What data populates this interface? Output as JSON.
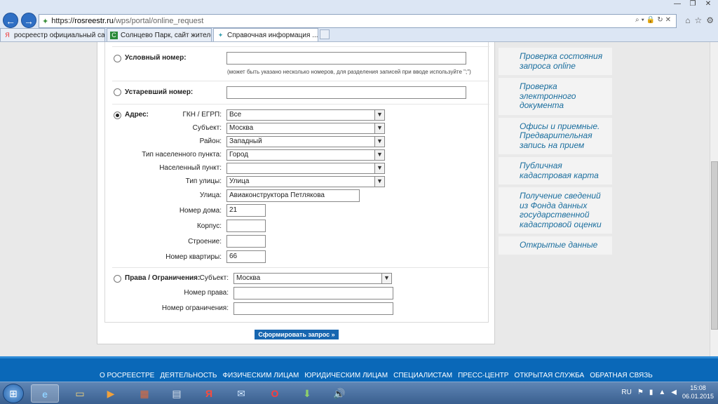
{
  "browser": {
    "url_domain": "rosreestr.ru",
    "url_path": "/wps/portal/online_request",
    "url_scheme": "https://",
    "tabs": [
      {
        "label": "росреестр официальный сай...",
        "favicon": "yandex-icon",
        "color": "#e33"
      },
      {
        "label": "Солнцево Парк, сайт жителе...",
        "favicon": "c-site-icon",
        "color": "#2a8a3a"
      },
      {
        "label": "Справочная информация ...",
        "favicon": "rosreestr-icon",
        "color": "#3aa0b0"
      }
    ]
  },
  "form": {
    "conditional_number": {
      "label": "Условный номер:",
      "value": "",
      "hint": "(может быть указано несколько номеров, для разделения записей при вводе используйте \";\")"
    },
    "old_number": {
      "label": "Устаревший номер:",
      "value": ""
    },
    "address": {
      "label": "Адрес:",
      "checked": true,
      "rows": [
        {
          "label": "ГКН / ЕГРП:",
          "type": "select",
          "value": "Все"
        },
        {
          "label": "Субъект:",
          "type": "select",
          "value": "Москва"
        },
        {
          "label": "Район:",
          "type": "select",
          "value": "Западный"
        },
        {
          "label": "Тип населенного пункта:",
          "type": "select",
          "value": "Город"
        },
        {
          "label": "Населенный пункт:",
          "type": "select",
          "value": ""
        },
        {
          "label": "Тип улицы:",
          "type": "select",
          "value": "Улица"
        },
        {
          "label": "Улица:",
          "type": "text",
          "value": "Авиаконструктора Петлякова"
        },
        {
          "label": "Номер дома:",
          "type": "text",
          "value": "21"
        },
        {
          "label": "Корпус:",
          "type": "text",
          "value": ""
        },
        {
          "label": "Строение:",
          "type": "text",
          "value": ""
        },
        {
          "label": "Номер квартиры:",
          "type": "text",
          "value": "66"
        }
      ]
    },
    "rights": {
      "label": "Права / Ограничения:",
      "subject_label": "Субъект:",
      "subject_value": "Москва",
      "right_number_label": "Номер права:",
      "right_number_value": "",
      "restriction_label": "Номер ограничения:",
      "restriction_value": ""
    },
    "submit_label": "Сформировать запрос »"
  },
  "sidebar": [
    "Проверка состояния запроса online",
    "Проверка электронного документа",
    "Офисы и приемные. Предварительная запись на прием",
    "Публичная кадастровая карта",
    "Получение сведений из Фонда данных государственной кадастровой оценки",
    "Открытые данные"
  ],
  "footer": [
    "О РОСРЕЕСТРЕ",
    "ДЕЯТЕЛЬНОСТЬ",
    "ФИЗИЧЕСКИМ ЛИЦАМ",
    "ЮРИДИЧЕСКИМ ЛИЦАМ",
    "СПЕЦИАЛИСТАМ",
    "ПРЕСС-ЦЕНТР",
    "ОТКРЫТАЯ СЛУЖБА",
    "ОБРАТНАЯ СВЯЗЬ"
  ],
  "taskbar": {
    "language": "RU",
    "time": "15:08",
    "date": "06.01.2015",
    "apps": [
      "windows-start-icon",
      "internet-explorer-icon",
      "file-explorer-icon",
      "media-player-icon",
      "package-icon",
      "calculator-icon",
      "yandex-browser-icon",
      "mail-icon",
      "opera-icon",
      "download-icon",
      "speaker-icon"
    ]
  }
}
